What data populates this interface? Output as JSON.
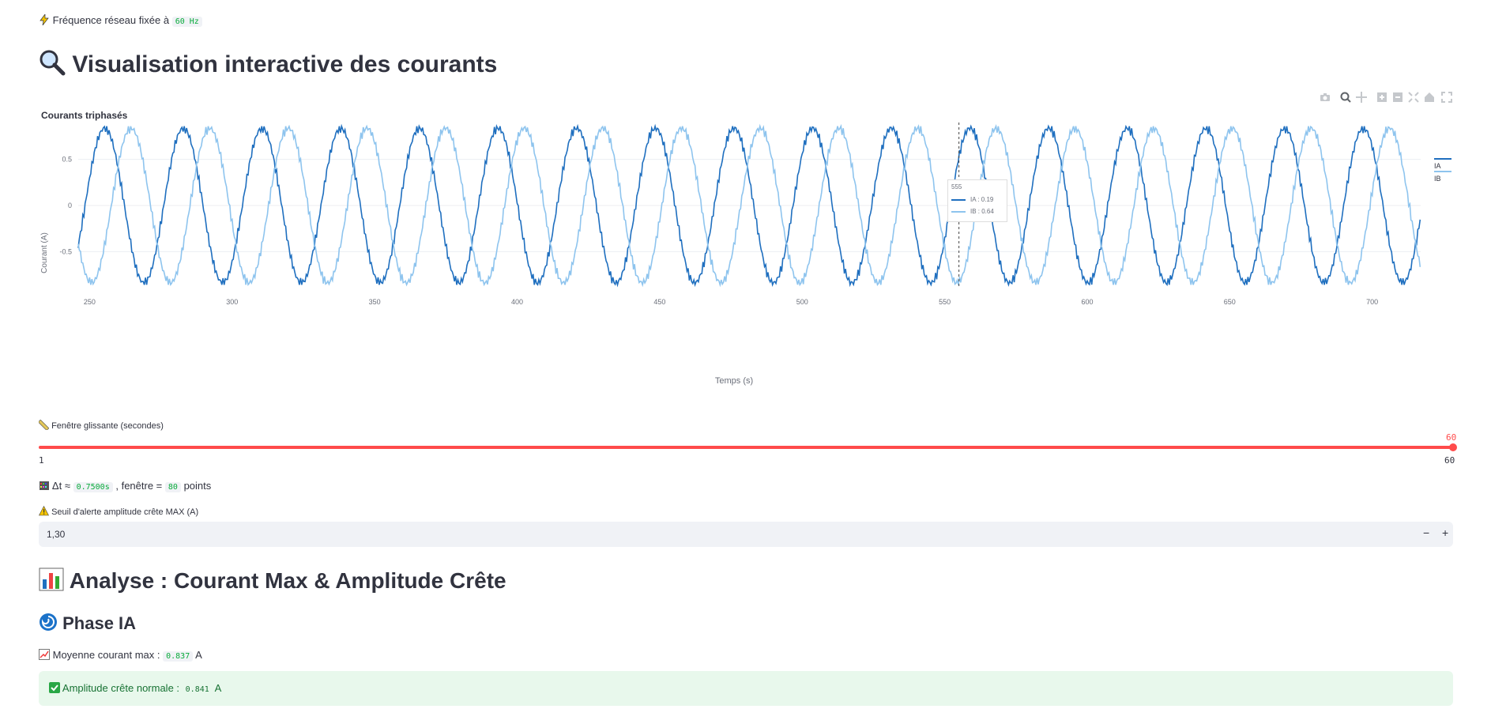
{
  "freq_line": {
    "prefix": "Fréquence réseau fixée à",
    "value": "60 Hz"
  },
  "header": {
    "title": "Visualisation interactive des courants"
  },
  "chart_toolbar": {
    "icons": [
      "camera-icon",
      "zoom-icon",
      "pan-icon",
      "zoom-in-icon",
      "zoom-out-icon",
      "autoscale-icon",
      "home-icon",
      "fullscreen-icon"
    ]
  },
  "chart_data": {
    "type": "line",
    "title": "Courants triphasés",
    "xlabel": "Temps (s)",
    "ylabel": "Courant (A)",
    "xlim": [
      246,
      717
    ],
    "ylim": [
      -0.9,
      0.9
    ],
    "xticks": [
      "250",
      "300",
      "350",
      "400",
      "450",
      "500",
      "550",
      "600",
      "650",
      "700"
    ],
    "yticks": [
      "0.5",
      "0",
      "-0.5"
    ],
    "series": [
      {
        "name": "IA",
        "color": "#1f6fbf",
        "amplitude": 0.84,
        "period": 27.6,
        "phase": 0
      },
      {
        "name": "IB",
        "color": "#8ec4ee",
        "amplitude": 0.84,
        "period": 27.6,
        "phase": 9.2
      }
    ],
    "tooltip": {
      "x": "555",
      "ia": "IA : 0.19",
      "ib": "IB : 0.64"
    },
    "legend_position": "top-right"
  },
  "slider": {
    "label": "Fenêtre glissante (secondes)",
    "min": "1",
    "max": "60",
    "value": "60",
    "value_num": 60
  },
  "dt_line": {
    "prefix": "Δt ≈",
    "dt": "0.7500s",
    "middle": ", fenêtre =",
    "points": "80",
    "suffix": "points"
  },
  "threshold": {
    "label": "Seuil d'alerte amplitude crête MAX (A)",
    "value": "1,30",
    "minus": "−",
    "plus": "+"
  },
  "analysis": {
    "title": "Analyse : Courant Max & Amplitude Crête"
  },
  "phase": {
    "title": "Phase IA"
  },
  "mean_line": {
    "prefix": "Moyenne courant max :",
    "value": "0.837",
    "unit": "A"
  },
  "success": {
    "prefix": "Amplitude crête normale :",
    "value": "0.841",
    "unit": "A"
  },
  "colors": {
    "accent": "#ff4b4b",
    "success_bg": "#e8f8ec",
    "success_text": "#177233",
    "code": "#09ab3b"
  }
}
